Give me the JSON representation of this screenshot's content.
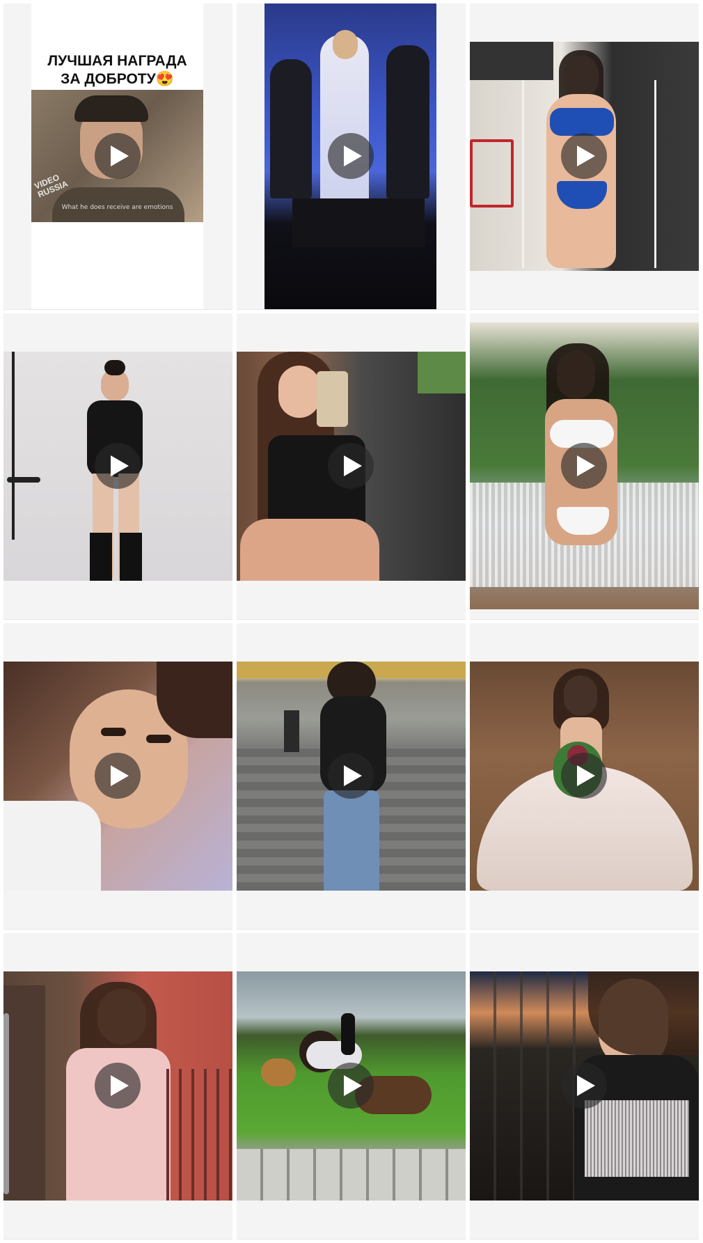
{
  "posts": [
    {
      "type": "video",
      "caption": "ЛУЧШАЯ НАГРАДА\nЗА ДОБРОТУ😍",
      "watermark": "VIDEO\nRUSSIA",
      "subtitle": "What he does receive are emotions",
      "icon": "play-icon"
    },
    {
      "type": "video",
      "icon": "play-icon"
    },
    {
      "type": "video",
      "icon": "play-icon"
    },
    {
      "type": "video",
      "icon": "play-icon"
    },
    {
      "type": "video",
      "icon": "play-icon"
    },
    {
      "type": "video",
      "icon": "play-icon"
    },
    {
      "type": "video",
      "icon": "play-icon"
    },
    {
      "type": "video",
      "icon": "play-icon"
    },
    {
      "type": "video",
      "icon": "play-icon"
    },
    {
      "type": "video",
      "icon": "play-icon"
    },
    {
      "type": "video",
      "icon": "play-icon"
    },
    {
      "type": "video",
      "icon": "play-icon"
    }
  ]
}
